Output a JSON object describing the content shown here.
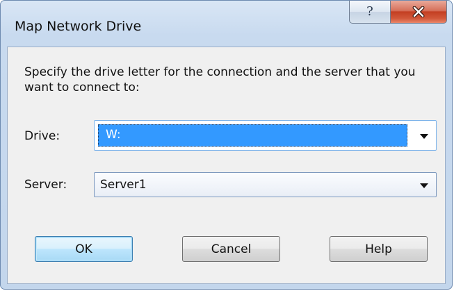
{
  "window": {
    "title": "Map Network Drive",
    "help_glyph": "?",
    "close_glyph": "x"
  },
  "instructions": "Specify the drive letter for the connection and the server that you want to connect to:",
  "drive": {
    "label": "Drive:",
    "value": "W:"
  },
  "server": {
    "label": "Server:",
    "value": "Server1"
  },
  "buttons": {
    "ok": "OK",
    "cancel": "Cancel",
    "help": "Help"
  },
  "colors": {
    "selection": "#3399ff",
    "close_button": "#c33f22",
    "dialog_frame": "#c3d6ec",
    "client_area": "#f0f0f0",
    "default_button": "#bee6fd"
  }
}
